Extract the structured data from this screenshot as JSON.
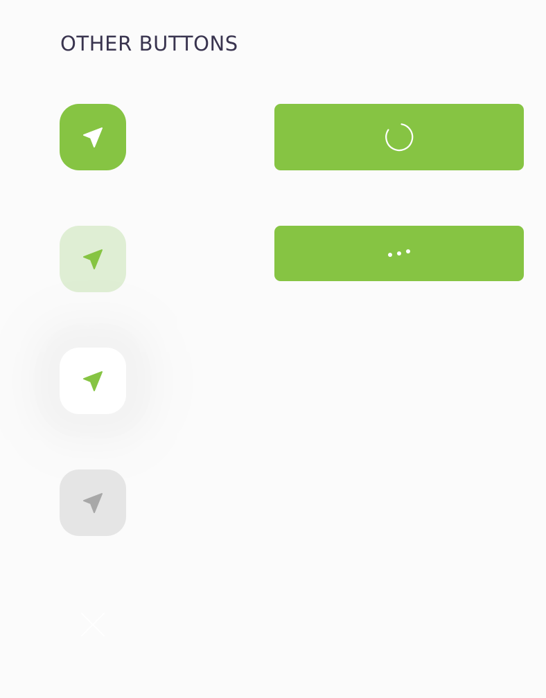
{
  "section": {
    "title": "OTHER BUTTONS"
  },
  "icons": {
    "send": "navigation-arrow-icon",
    "spinner": "loading-spinner-icon",
    "dots": "ellipsis-dots-icon",
    "close": "close-icon"
  },
  "colors": {
    "accent": "#86c443",
    "accent_soft": "#dfeed4",
    "disabled_bg": "#e5e5e5",
    "disabled_icon": "#a8a8a8",
    "title_text": "#39344f",
    "page_bg": "#fbfbfb"
  },
  "buttons": [
    {
      "variant": "primary",
      "state": "default"
    },
    {
      "variant": "soft",
      "state": "default"
    },
    {
      "variant": "white",
      "state": "default"
    },
    {
      "variant": "neutral",
      "state": "disabled"
    },
    {
      "variant": "close",
      "state": "default"
    }
  ],
  "wide_buttons": [
    {
      "state": "loading"
    },
    {
      "state": "processing"
    }
  ]
}
